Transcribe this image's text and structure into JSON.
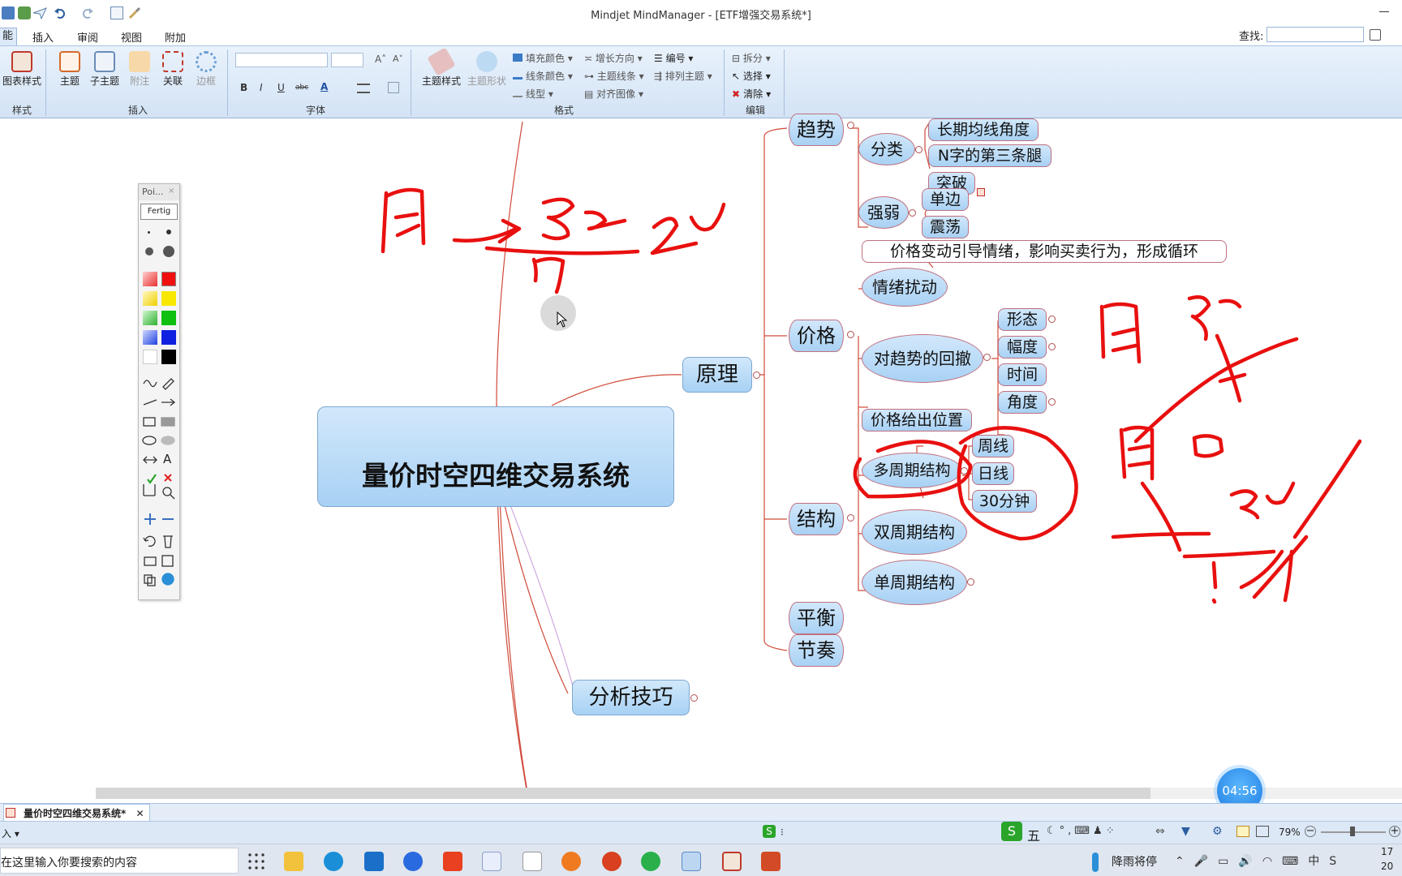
{
  "window": {
    "title": "Mindjet MindManager - [ETF增强交易系统*]"
  },
  "ribbon": {
    "tabs": [
      "能",
      "插入",
      "审阅",
      "视图",
      "附加"
    ],
    "find_label": "查找:",
    "groups": {
      "style": {
        "label": "样式",
        "button": "图表样式"
      },
      "insert": {
        "label": "插入",
        "buttons": [
          "主题",
          "子主题",
          "附注",
          "关联",
          "边框"
        ]
      },
      "font": {
        "label": "字体",
        "buttons": [
          "B",
          "I",
          "U",
          "abc",
          "A"
        ]
      },
      "format": {
        "label": "格式",
        "buttons": [
          "主题样式",
          "主题形状"
        ],
        "small": [
          "填充颜色",
          "线条颜色",
          "线型",
          "增长方向",
          "主题线条",
          "对齐图像",
          "编号",
          "排列主题"
        ]
      },
      "edit": {
        "label": "编辑",
        "small": [
          "拆分",
          "选择",
          "清除"
        ]
      }
    }
  },
  "mindmap": {
    "central": "量价时空四维交易系统",
    "principle": "原理",
    "analysis": "分析技巧",
    "trend": "趋势",
    "trend_classify": "分类",
    "trend_classify_items": [
      "长期均线角度",
      "N字的第三条腿",
      "突破"
    ],
    "trend_strength": "强弱",
    "trend_strength_items": [
      "单边",
      "震荡"
    ],
    "price": "价格",
    "price_note": "价格变动引导情绪，影响买卖行为，形成循环",
    "price_emotion": "情绪扰动",
    "price_pullback": "对趋势的回撤",
    "price_pullback_items": [
      "形态",
      "幅度",
      "时间",
      "角度"
    ],
    "price_position": "价格给出位置",
    "structure": "结构",
    "structure_multi": "多周期结构",
    "structure_multi_items": [
      "周线",
      "日线",
      "30分钟"
    ],
    "structure_dual": "双周期结构",
    "structure_single": "单周期结构",
    "balance": "平衡",
    "rhythm": "节奏"
  },
  "palette": {
    "title": "Poi...",
    "done": "Fertig",
    "text_tool": "A"
  },
  "doc_tab": "量价时空四维交易系统*",
  "status": {
    "zoom": "79%",
    "ime": "五"
  },
  "taskbar": {
    "search_placeholder": "在这里输入你要搜索的内容",
    "weather": "降雨将停",
    "time": "17",
    "date": "20"
  },
  "timer": "04:56",
  "annotation_color": "#e8100f"
}
